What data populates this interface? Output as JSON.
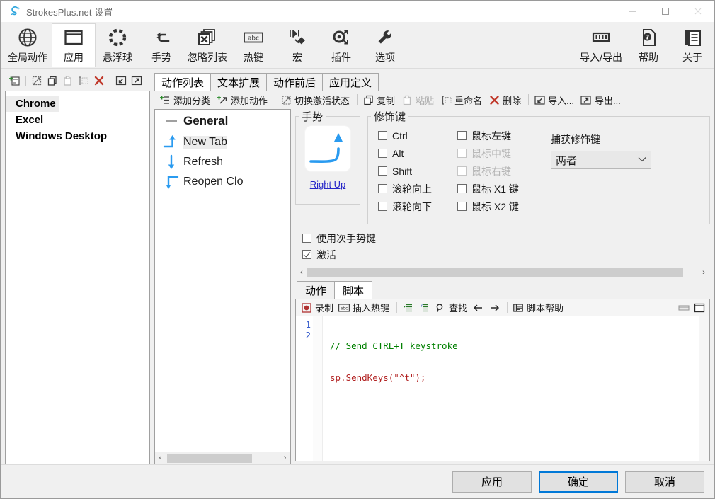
{
  "window": {
    "title": "StrokesPlus.net 设置",
    "icon": "app-logo-icon",
    "minimize": "minimize-icon",
    "maximize": "maximize-icon",
    "close": "close-icon"
  },
  "ribbon": {
    "items": [
      {
        "label": "全局动作",
        "icon": "globe-icon",
        "selected": false
      },
      {
        "label": "应用",
        "icon": "window-icon",
        "selected": true
      },
      {
        "label": "悬浮球",
        "icon": "dotted-circle-icon",
        "selected": false
      },
      {
        "label": "手势",
        "icon": "gesture-arrow-icon",
        "selected": false
      },
      {
        "label": "忽略列表",
        "icon": "stacked-x-icon",
        "selected": false
      },
      {
        "label": "热键",
        "icon": "abc-key-icon",
        "selected": false
      },
      {
        "label": "宏",
        "icon": "macro-play-icon",
        "selected": false
      },
      {
        "label": "插件",
        "icon": "plugin-icon",
        "selected": false
      }
    ],
    "right_items": [
      {
        "label": "导入/导出",
        "icon": "import-export-icon"
      },
      {
        "label": "帮助",
        "icon": "help-doc-icon"
      },
      {
        "label": "关于",
        "icon": "about-info-icon"
      }
    ]
  },
  "left_pane": {
    "toolbar": [
      {
        "name": "add-app-icon",
        "disabled": false
      },
      {
        "name": "toggle-enabled-icon",
        "disabled": false
      },
      {
        "name": "copy-icon",
        "disabled": false
      },
      {
        "name": "paste-icon",
        "disabled": true
      },
      {
        "name": "rename-icon",
        "disabled": true
      },
      {
        "name": "delete-icon",
        "disabled": false
      },
      {
        "name": "import-icon",
        "disabled": false
      },
      {
        "name": "export-icon",
        "disabled": false
      }
    ],
    "apps": [
      {
        "label": "Chrome",
        "selected": true
      },
      {
        "label": "Excel",
        "selected": false
      },
      {
        "label": "Windows Desktop",
        "selected": false
      }
    ]
  },
  "tabs": [
    {
      "label": "动作列表",
      "active": true
    },
    {
      "label": "文本扩展",
      "active": false
    },
    {
      "label": "动作前后",
      "active": false
    },
    {
      "label": "应用定义",
      "active": false
    }
  ],
  "commands": [
    {
      "label": "添加分类",
      "icon": "add-category-icon",
      "disabled": false
    },
    {
      "label": "添加动作",
      "icon": "add-action-icon",
      "disabled": false
    },
    {
      "label": "切换激活状态",
      "icon": "toggle-active-icon",
      "disabled": false
    },
    {
      "label": "复制",
      "icon": "copy-icon",
      "disabled": false
    },
    {
      "label": "粘贴",
      "icon": "paste-icon",
      "disabled": true
    },
    {
      "label": "重命名",
      "icon": "rename-icon",
      "disabled": false
    },
    {
      "label": "删除",
      "icon": "delete-x-icon",
      "disabled": false
    },
    {
      "label": "导入...",
      "icon": "import-icon",
      "disabled": false
    },
    {
      "label": "导出...",
      "icon": "export-icon",
      "disabled": false
    }
  ],
  "tree": {
    "category": "General",
    "nodes": [
      {
        "label": "New Tab",
        "gesture": "right-up-icon",
        "selected": true
      },
      {
        "label": "Refresh",
        "gesture": "down-icon",
        "selected": false
      },
      {
        "label": "Reopen Clo",
        "gesture": "down-left-icon",
        "selected": false
      }
    ],
    "scroll_left": "‹",
    "scroll_right": "›"
  },
  "gesture_group": {
    "legend": "手势",
    "preview_icon": "right-up-stroke-icon",
    "link": "Right Up"
  },
  "modifier_group": {
    "legend": "修饰键",
    "column1": [
      {
        "label": "Ctrl",
        "checked": false,
        "disabled": false
      },
      {
        "label": "Alt",
        "checked": false,
        "disabled": false
      },
      {
        "label": "Shift",
        "checked": false,
        "disabled": false
      },
      {
        "label": "滚轮向上",
        "checked": false,
        "disabled": false
      },
      {
        "label": "滚轮向下",
        "checked": false,
        "disabled": false
      }
    ],
    "column2": [
      {
        "label": "鼠标左键",
        "checked": false,
        "disabled": false
      },
      {
        "label": "鼠标中键",
        "checked": false,
        "disabled": true
      },
      {
        "label": "鼠标右键",
        "checked": false,
        "disabled": true
      },
      {
        "label": "鼠标 X1 键",
        "checked": false,
        "disabled": false
      },
      {
        "label": "鼠标 X2 键",
        "checked": false,
        "disabled": false
      }
    ],
    "capture_label": "捕获修饰键",
    "capture_value": "两者",
    "capture_chevron": "chevron-down-icon"
  },
  "options": [
    {
      "label": "使用次手势键",
      "checked": false
    },
    {
      "label": "激活",
      "checked": true
    }
  ],
  "script_tabs": [
    {
      "label": "动作",
      "active": false
    },
    {
      "label": "脚本",
      "active": true
    }
  ],
  "editor_toolbar": [
    {
      "label": "录制",
      "icon": "record-icon"
    },
    {
      "label": "插入热键",
      "icon": "insert-hotkey-icon"
    },
    {
      "label": "",
      "icon": "indent-icon"
    },
    {
      "label": "",
      "icon": "intellisense-icon"
    },
    {
      "label": "查找",
      "icon": "search-icon"
    },
    {
      "label": "",
      "icon": "arrow-left-icon"
    },
    {
      "label": "",
      "icon": "arrow-right-icon"
    },
    {
      "label": "脚本帮助",
      "icon": "script-help-icon"
    }
  ],
  "editor_window_controls": [
    {
      "icon": "restore-down-icon"
    },
    {
      "icon": "maximize-editor-icon"
    }
  ],
  "code": {
    "lines": [
      {
        "num": "1",
        "comment": "// Send CTRL+T keystroke"
      },
      {
        "num": "2",
        "ident": "sp.SendKeys(\"^t\");"
      }
    ]
  },
  "footer": {
    "apply": "应用",
    "ok": "确定",
    "cancel": "取消"
  },
  "colors": {
    "accent": "#0078d7",
    "gesture_blue": "#2a9bf0",
    "link": "#2727c8",
    "comment_green": "#008000",
    "code_red": "#b22222"
  }
}
